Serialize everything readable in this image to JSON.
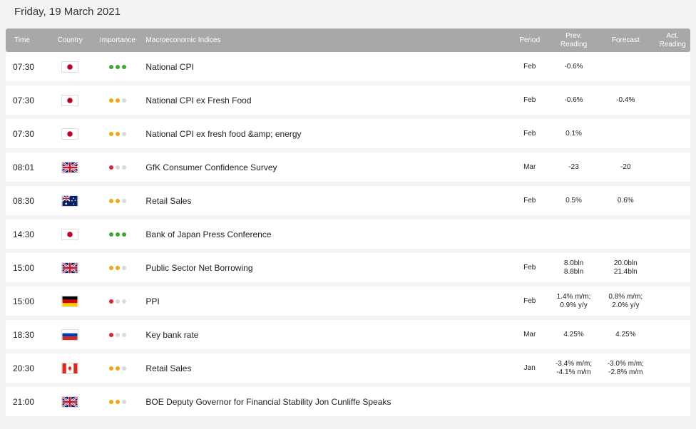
{
  "date_title": "Friday, 19 March 2021",
  "headers": {
    "time": "Time",
    "country": "Country",
    "importance": "Importance",
    "indices": "Macroeconomic Indices",
    "period": "Period",
    "prev": [
      "Prev.",
      "Reading"
    ],
    "forecast": "Forecast",
    "act": [
      "Act.",
      "Reading"
    ]
  },
  "colors": {
    "high": "#3fa535",
    "medium": "#f2a60c",
    "low": "#e2232a",
    "off": "#d9d9d9",
    "header_bg": "#a7a8aa"
  },
  "rows": [
    {
      "time": "07:30",
      "country": "japan-flag",
      "importance": "high",
      "index": "National CPI",
      "period": "Feb",
      "prev": [
        "-0.6%"
      ],
      "forecast": [],
      "actual": []
    },
    {
      "time": "07:30",
      "country": "japan-flag",
      "importance": "medium",
      "index": "National CPI ex Fresh Food",
      "period": "Feb",
      "prev": [
        "-0.6%"
      ],
      "forecast": [
        "-0.4%"
      ],
      "actual": []
    },
    {
      "time": "07:30",
      "country": "japan-flag",
      "importance": "medium",
      "index": "National CPI ex fresh food &amp; energy",
      "period": "Feb",
      "prev": [
        "0.1%"
      ],
      "forecast": [],
      "actual": []
    },
    {
      "time": "08:01",
      "country": "uk-flag",
      "importance": "low",
      "index": "GfK Consumer Confidence Survey",
      "period": "Mar",
      "prev": [
        "-23"
      ],
      "forecast": [
        "-20"
      ],
      "actual": []
    },
    {
      "time": "08:30",
      "country": "australia-flag",
      "importance": "medium",
      "index": "Retail Sales",
      "period": "Feb",
      "prev": [
        "0.5%"
      ],
      "forecast": [
        "0.6%"
      ],
      "actual": []
    },
    {
      "time": "14:30",
      "country": "japan-flag",
      "importance": "high",
      "index": "Bank of Japan Press Conference",
      "period": "",
      "prev": [],
      "forecast": [],
      "actual": []
    },
    {
      "time": "15:00",
      "country": "uk-flag",
      "importance": "medium",
      "index": "Public Sector Net Borrowing",
      "period": "Feb",
      "prev": [
        "8.0bln",
        "8.8bln"
      ],
      "forecast": [
        "20.0bln",
        "21.4bln"
      ],
      "actual": []
    },
    {
      "time": "15:00",
      "country": "germany-flag",
      "importance": "low",
      "index": "PPI",
      "period": "Feb",
      "prev": [
        "1.4% m/m;",
        "0.9% y/y"
      ],
      "forecast": [
        "0.8% m/m;",
        "2.0% y/y"
      ],
      "actual": []
    },
    {
      "time": "18:30",
      "country": "russia-flag",
      "importance": "low",
      "index": "Key bank rate",
      "period": "Mar",
      "prev": [
        "4.25%"
      ],
      "forecast": [
        "4.25%"
      ],
      "actual": []
    },
    {
      "time": "20:30",
      "country": "canada-flag",
      "importance": "medium",
      "index": "Retail Sales",
      "period": "Jan",
      "prev": [
        "-3.4% m/m;",
        "-4.1% m/m"
      ],
      "forecast": [
        "-3.0% m/m;",
        "-2.8% m/m"
      ],
      "actual": []
    },
    {
      "time": "21:00",
      "country": "uk-flag",
      "importance": "medium",
      "index": "BOE Deputy Governor for Financial Stability Jon Cunliffe Speaks",
      "period": "",
      "prev": [],
      "forecast": [],
      "actual": []
    }
  ]
}
